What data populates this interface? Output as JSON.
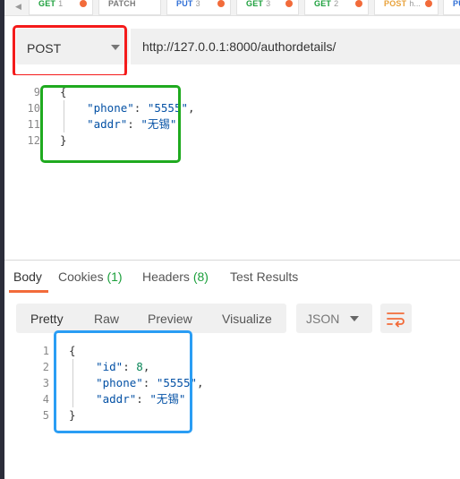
{
  "tabs": [
    {
      "method": "GET",
      "name": "1",
      "method_class": "m-get",
      "dot": true
    },
    {
      "method": "PATCH",
      "name": "",
      "method_class": "m-patch",
      "dot": false
    },
    {
      "method": "PUT",
      "name": "3",
      "method_class": "m-put",
      "dot": true
    },
    {
      "method": "GET",
      "name": "3",
      "method_class": "m-get",
      "dot": true
    },
    {
      "method": "GET",
      "name": "2",
      "method_class": "m-get",
      "dot": true
    },
    {
      "method": "POST",
      "name": "h...",
      "method_class": "m-post",
      "dot": true
    },
    {
      "method": "PU",
      "name": "",
      "method_class": "m-put",
      "dot": false
    }
  ],
  "request": {
    "method": "POST",
    "url": "http://127.0.0.1:8000/authordetails/"
  },
  "request_body": {
    "line_numbers": [
      "9",
      "10",
      "11",
      "12"
    ],
    "lines": [
      [
        {
          "t": "{",
          "c": "tok-punc"
        }
      ],
      [
        {
          "t": "    ",
          "c": ""
        },
        {
          "t": "\"phone\"",
          "c": "tok-key"
        },
        {
          "t": ": ",
          "c": "tok-punc"
        },
        {
          "t": "\"5555\"",
          "c": "tok-str"
        },
        {
          "t": ",",
          "c": "tok-punc"
        }
      ],
      [
        {
          "t": "    ",
          "c": ""
        },
        {
          "t": "\"addr\"",
          "c": "tok-key"
        },
        {
          "t": ": ",
          "c": "tok-punc"
        },
        {
          "t": "\"无锡\"",
          "c": "tok-str"
        }
      ],
      [
        {
          "t": "}",
          "c": "tok-punc"
        }
      ]
    ]
  },
  "response_tabs": {
    "body": "Body",
    "cookies": "Cookies",
    "cookies_count": "(1)",
    "headers": "Headers",
    "headers_count": "(8)",
    "test_results": "Test Results"
  },
  "view_modes": {
    "pretty": "Pretty",
    "raw": "Raw",
    "preview": "Preview",
    "visualize": "Visualize"
  },
  "format": {
    "selected": "JSON"
  },
  "response_body": {
    "line_numbers": [
      "1",
      "2",
      "3",
      "4",
      "5"
    ],
    "lines": [
      [
        {
          "t": "{",
          "c": "tok-punc"
        }
      ],
      [
        {
          "t": "    ",
          "c": ""
        },
        {
          "t": "\"id\"",
          "c": "tok-key"
        },
        {
          "t": ": ",
          "c": "tok-punc"
        },
        {
          "t": "8",
          "c": "tok-num"
        },
        {
          "t": ",",
          "c": "tok-punc"
        }
      ],
      [
        {
          "t": "    ",
          "c": ""
        },
        {
          "t": "\"phone\"",
          "c": "tok-key"
        },
        {
          "t": ": ",
          "c": "tok-punc"
        },
        {
          "t": "\"5555\"",
          "c": "tok-str"
        },
        {
          "t": ",",
          "c": "tok-punc"
        }
      ],
      [
        {
          "t": "    ",
          "c": ""
        },
        {
          "t": "\"addr\"",
          "c": "tok-key"
        },
        {
          "t": ": ",
          "c": "tok-punc"
        },
        {
          "t": "\"无锡\"",
          "c": "tok-str"
        }
      ],
      [
        {
          "t": "}",
          "c": "tok-punc"
        }
      ]
    ]
  },
  "colors": {
    "highlight_red": "#f41b1b",
    "highlight_green": "#1faa1f",
    "highlight_blue": "#2a9df4",
    "accent": "#f26b3a"
  }
}
